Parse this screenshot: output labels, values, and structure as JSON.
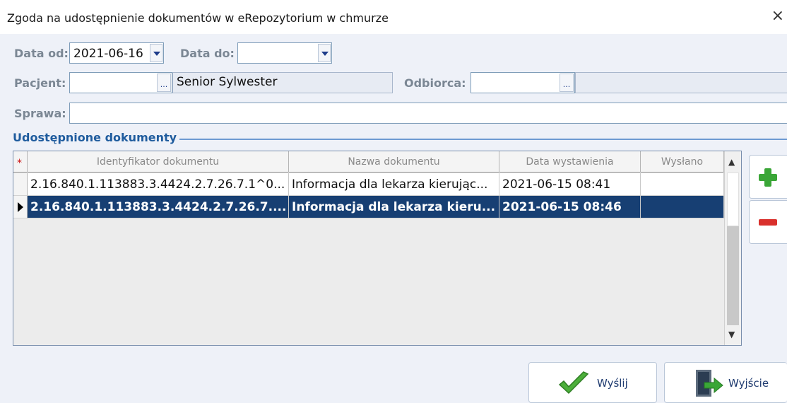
{
  "window": {
    "title": "Zgoda na udostępnienie dokumentów w eRepozytorium w chmurze",
    "close": "×"
  },
  "filters": {
    "date_from_label": "Data od:",
    "date_from_value": "2021-06-16",
    "date_to_label": "Data do:",
    "date_to_value": "",
    "patient_label": "Pacjent:",
    "patient_code": "",
    "patient_name": "Senior Sylwester",
    "patient_lookup": "...",
    "recipient_label": "Odbiorca:",
    "recipient_code": "",
    "recipient_lookup": "...",
    "case_label": "Sprawa:",
    "case_value": ""
  },
  "documents": {
    "group_title": "Udostępnione dokumenty",
    "new_row_marker": "*",
    "columns": [
      "Identyfikator dokumentu",
      "Nazwa dokumentu",
      "Data wystawienia",
      "Wysłano"
    ],
    "rows": [
      {
        "id": "2.16.840.1.113883.3.4424.2.7.26.7.1^0...",
        "name": "Informacja dla lekarza kierując...",
        "date": "2021-06-15 08:41",
        "sent": ""
      },
      {
        "id": "2.16.840.1.113883.3.4424.2.7.26.7....",
        "name": "Informacja dla lekarza kieru...",
        "date": "2021-06-15 08:46",
        "sent": ""
      }
    ],
    "selected_row": 1
  },
  "buttons": {
    "send": "Wyślij",
    "exit": "Wyjście"
  },
  "colors": {
    "selection": "#173f73",
    "add": "#3aa637",
    "remove": "#d9302c",
    "group_title": "#1f5c9e"
  }
}
